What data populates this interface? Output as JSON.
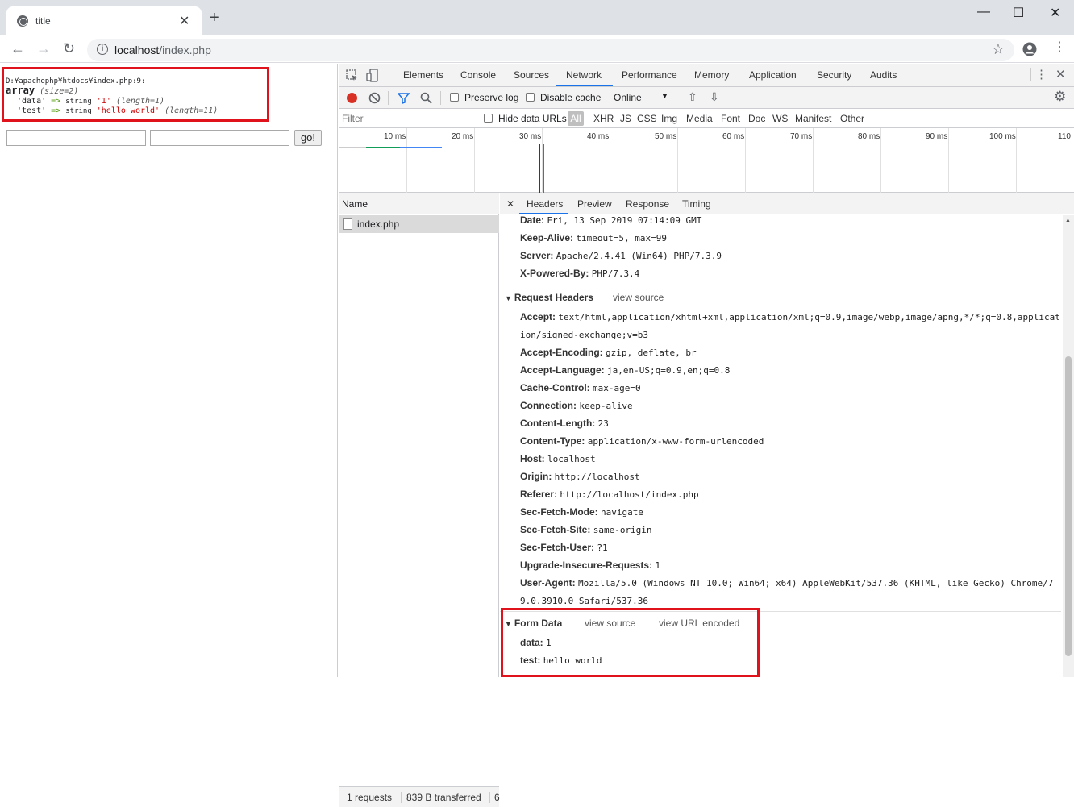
{
  "browser": {
    "tab_title": "title",
    "tab_close": "✕",
    "new_tab": "+",
    "window_controls": [
      "—",
      "☐",
      "✕"
    ],
    "address": {
      "host": "localhost",
      "path": "/index.php"
    }
  },
  "page": {
    "dump": {
      "path": "D:¥apachephp¥htdocs¥index.php:9:",
      "array_kw": "array",
      "size": "(size=2)",
      "entries": [
        {
          "key": "'data'",
          "arrow": "=>",
          "type": "string",
          "value": "'1'",
          "length": "(length=1)"
        },
        {
          "key": "'test'",
          "arrow": "=>",
          "type": "string",
          "value": "'hello world'",
          "length": "(length=11)"
        }
      ]
    },
    "go_label": "go!"
  },
  "devtools": {
    "tabs": [
      "Elements",
      "Console",
      "Sources",
      "Network",
      "Performance",
      "Memory",
      "Application",
      "Security",
      "Audits"
    ],
    "active_tab": "Network",
    "network_bar": {
      "preserve_log": "Preserve log",
      "disable_cache": "Disable cache",
      "throttle": "Online"
    },
    "filter": {
      "placeholder": "Filter",
      "hide_data_urls": "Hide data URLs",
      "types": [
        "All",
        "XHR",
        "JS",
        "CSS",
        "Img",
        "Media",
        "Font",
        "Doc",
        "WS",
        "Manifest",
        "Other"
      ]
    },
    "timeline_ticks": [
      "10 ms",
      "20 ms",
      "30 ms",
      "40 ms",
      "50 ms",
      "60 ms",
      "70 ms",
      "80 ms",
      "90 ms",
      "100 ms",
      "110"
    ],
    "name_header": "Name",
    "requests": [
      "index.php"
    ],
    "status": {
      "requests": "1 requests",
      "transferred": "839 B transferred",
      "more": "6"
    },
    "detail_tabs": [
      "Headers",
      "Preview",
      "Response",
      "Timing"
    ],
    "detail_close": "✕",
    "response_headers": [
      {
        "k": "Date:",
        "v": "Fri, 13 Sep 2019 07:14:09 GMT"
      },
      {
        "k": "Keep-Alive:",
        "v": "timeout=5, max=99"
      },
      {
        "k": "Server:",
        "v": "Apache/2.4.41 (Win64) PHP/7.3.9"
      },
      {
        "k": "X-Powered-By:",
        "v": "PHP/7.3.4"
      }
    ],
    "request_headers_title": "Request Headers",
    "view_source": "view source",
    "view_url_encoded": "view URL encoded",
    "request_headers": [
      {
        "k": "Accept:",
        "v": "text/html,application/xhtml+xml,application/xml;q=0.9,image/webp,image/apng,*/*;q=0.8,applicat"
      },
      {
        "k": "",
        "v": "ion/signed-exchange;v=b3"
      },
      {
        "k": "Accept-Encoding:",
        "v": "gzip, deflate, br"
      },
      {
        "k": "Accept-Language:",
        "v": "ja,en-US;q=0.9,en;q=0.8"
      },
      {
        "k": "Cache-Control:",
        "v": "max-age=0"
      },
      {
        "k": "Connection:",
        "v": "keep-alive"
      },
      {
        "k": "Content-Length:",
        "v": "23"
      },
      {
        "k": "Content-Type:",
        "v": "application/x-www-form-urlencoded"
      },
      {
        "k": "Host:",
        "v": "localhost"
      },
      {
        "k": "Origin:",
        "v": "http://localhost"
      },
      {
        "k": "Referer:",
        "v": "http://localhost/index.php"
      },
      {
        "k": "Sec-Fetch-Mode:",
        "v": "navigate"
      },
      {
        "k": "Sec-Fetch-Site:",
        "v": "same-origin"
      },
      {
        "k": "Sec-Fetch-User:",
        "v": "?1"
      },
      {
        "k": "Upgrade-Insecure-Requests:",
        "v": "1"
      },
      {
        "k": "User-Agent:",
        "v": "Mozilla/5.0 (Windows NT 10.0; Win64; x64) AppleWebKit/537.36 (KHTML, like Gecko) Chrome/7"
      },
      {
        "k": "",
        "v": "9.0.3910.0 Safari/537.36"
      }
    ],
    "form_data_title": "Form Data",
    "form_data": [
      {
        "k": "data:",
        "v": "1"
      },
      {
        "k": "test:",
        "v": "hello world"
      }
    ]
  }
}
